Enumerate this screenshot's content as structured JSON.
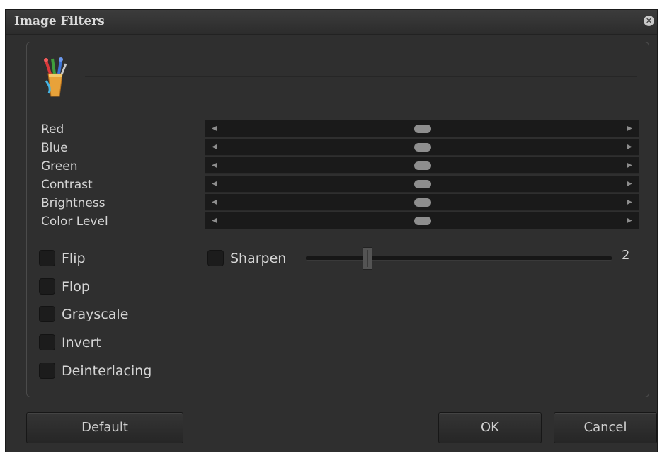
{
  "window": {
    "title": "Image Filters",
    "close_glyph": "✕"
  },
  "sliders": [
    {
      "label": "Red"
    },
    {
      "label": "Blue"
    },
    {
      "label": "Green"
    },
    {
      "label": "Contrast"
    },
    {
      "label": "Brightness"
    },
    {
      "label": "Color Level"
    }
  ],
  "slider_arrows": {
    "left": "◀",
    "right": "▶"
  },
  "checkboxes": [
    {
      "label": "Flip",
      "checked": false
    },
    {
      "label": "Flop",
      "checked": false
    },
    {
      "label": "Grayscale",
      "checked": false
    },
    {
      "label": "Invert",
      "checked": false
    },
    {
      "label": "Deinterlacing",
      "checked": false
    }
  ],
  "sharpen": {
    "label": "Sharpen",
    "checked": false,
    "value": "2"
  },
  "buttons": {
    "default": "Default",
    "ok": "OK",
    "cancel": "Cancel"
  },
  "icons": {
    "header": "paint-brushes-icon",
    "close": "close-icon"
  }
}
